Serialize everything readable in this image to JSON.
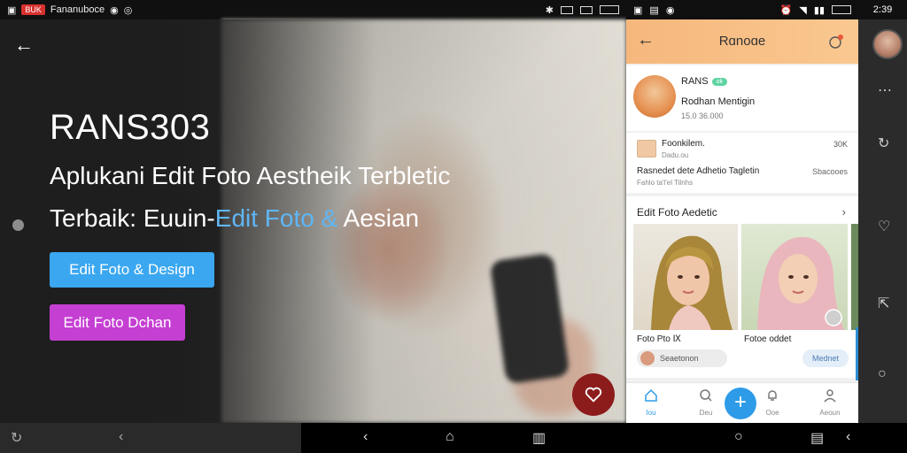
{
  "status_left": {
    "badge": "BUK",
    "title": "Fananuboce"
  },
  "status_phone": {
    "time": ""
  },
  "status_right": {
    "time": "2:39"
  },
  "hero": {
    "title": "RANS303",
    "line1": "Aplukani Edit Foto Aestheik Terbletic",
    "line2_a": "Terbaik: Euuin-",
    "line2_highlight": "Edit Foto &",
    "line2_b": " Aesian",
    "btn_primary": "Edit Foto & Design",
    "btn_secondary": "Edit Foto Dchan"
  },
  "phone": {
    "appbar_title": "Rɑnoɑe",
    "profile": {
      "name": "RANS",
      "badge": "ok",
      "subtitle": "Rodhan Mentigin",
      "meta": "15.0  36.000"
    },
    "post": {
      "name": "Foonkilem.",
      "sub": "Dadu.ou",
      "count": "30K",
      "title": "Rasnedet dete Adhetio Tagletin",
      "link": "Sbacooes",
      "desc": "Fahlo ta'l'el Tilnhs"
    },
    "gallery": {
      "title": "Edit Foto Aedetic",
      "caption_left": "Foto Pto  Ⅸ",
      "caption_right": "Fotoe oddet",
      "chip_left": "Seaetonon",
      "chip_right": "Mednet"
    },
    "bottom_nav": [
      {
        "label": "Iou",
        "icon": "home-icon"
      },
      {
        "label": "Deu",
        "icon": "search-icon"
      },
      {
        "label": "",
        "icon": "plus-icon"
      },
      {
        "label": "Ooe",
        "icon": "bell-icon"
      },
      {
        "label": "Aeoun",
        "icon": "user-icon"
      }
    ]
  },
  "colors": {
    "accent_blue": "#3aa7f0",
    "accent_purple": "#c53fd3",
    "appbar_orange": "#f6b77c",
    "fab_red": "#8c1c1c",
    "nav_blue": "#2d9be8"
  }
}
